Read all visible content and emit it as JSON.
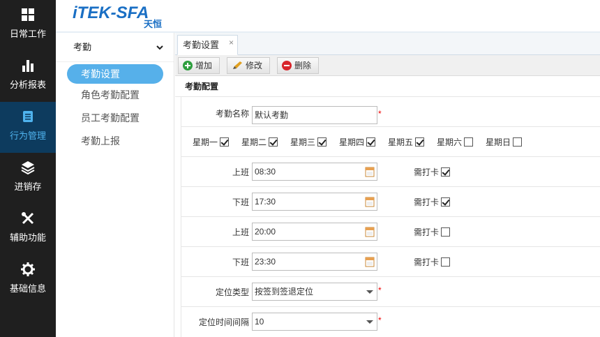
{
  "brand": {
    "logo_text": "iTEK-SFA",
    "logo_sub": "天恒"
  },
  "nav": [
    {
      "label": "日常工作",
      "icon": "grid-icon"
    },
    {
      "label": "分析报表",
      "icon": "bar-chart-icon"
    },
    {
      "label": "行为管理",
      "icon": "document-icon"
    },
    {
      "label": "进销存",
      "icon": "layers-icon"
    },
    {
      "label": "辅助功能",
      "icon": "tools-icon"
    },
    {
      "label": "基础信息",
      "icon": "gear-icon"
    }
  ],
  "submenu": {
    "header": "考勤",
    "items": [
      "考勤设置",
      "角色考勤配置",
      "员工考勤配置",
      "考勤上报"
    ]
  },
  "tab": {
    "label": "考勤设置",
    "close": "×"
  },
  "toolbar": {
    "add": "增加",
    "edit": "修改",
    "delete": "删除"
  },
  "section_title": "考勤配置",
  "form": {
    "name_label": "考勤名称",
    "name_value": "默认考勤",
    "required_mark": "*",
    "weekdays": [
      {
        "label": "星期一",
        "checked": true
      },
      {
        "label": "星期二",
        "checked": true
      },
      {
        "label": "星期三",
        "checked": true
      },
      {
        "label": "星期四",
        "checked": true
      },
      {
        "label": "星期五",
        "checked": true
      },
      {
        "label": "星期六",
        "checked": false
      },
      {
        "label": "星期日",
        "checked": false
      }
    ],
    "shifts": [
      {
        "label": "上班",
        "time": "08:30",
        "punch_label": "需打卡",
        "punch": true
      },
      {
        "label": "下班",
        "time": "17:30",
        "punch_label": "需打卡",
        "punch": true
      },
      {
        "label": "上班",
        "time": "20:00",
        "punch_label": "需打卡",
        "punch": false
      },
      {
        "label": "下班",
        "time": "23:30",
        "punch_label": "需打卡",
        "punch": false
      }
    ],
    "locate_type_label": "定位类型",
    "locate_type_value": "按签到签退定位",
    "locate_interval_label": "定位时间间隔",
    "locate_interval_value": "10"
  },
  "colors": {
    "nav_bg": "#1f1f1f",
    "nav_active_bg": "#0d3b5e",
    "accent": "#56b0ea",
    "brand": "#1a6fc4"
  }
}
